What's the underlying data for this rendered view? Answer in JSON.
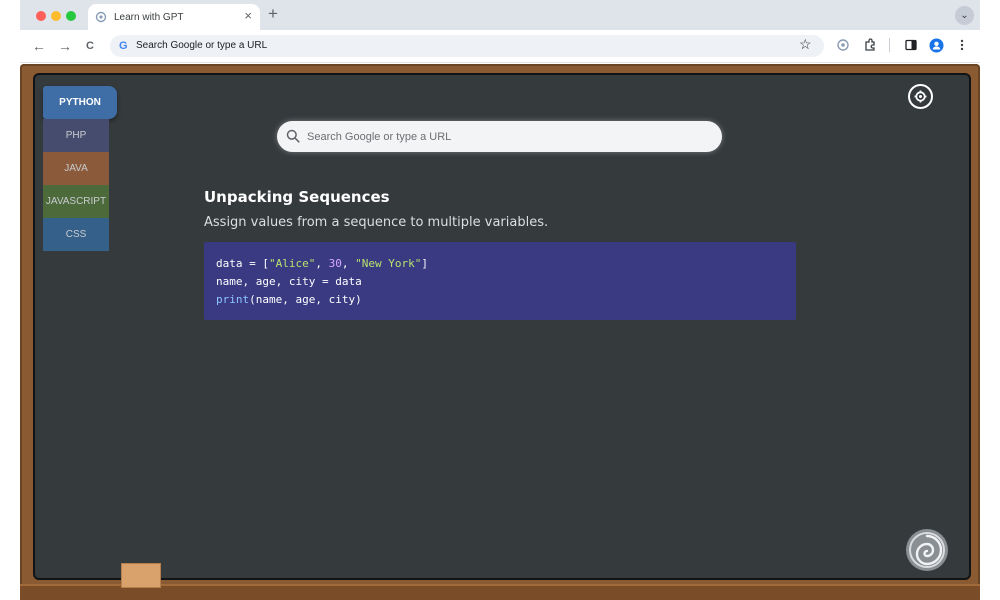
{
  "browser": {
    "tab_title": "Learn with GPT",
    "tab_close": "×",
    "new_tab": "+",
    "address_placeholder": "Search Google or type a URL",
    "nav_back": "←",
    "nav_forward": "→",
    "nav_reload": "C",
    "omnibox_g": "G",
    "star": "☆",
    "tab_menu": "⌄"
  },
  "languages": [
    {
      "label": "PYTHON",
      "color": "#3f6ea6",
      "active": true
    },
    {
      "label": "PHP",
      "color": "#454c6e",
      "active": false
    },
    {
      "label": "JAVA",
      "color": "#8a5a3a",
      "active": false
    },
    {
      "label": "JAVASCRIPT",
      "color": "#4d6a3b",
      "active": false
    },
    {
      "label": "CSS",
      "color": "#356089",
      "active": false
    }
  ],
  "search": {
    "placeholder": "Search Google or type a URL"
  },
  "lesson": {
    "title": "Unpacking Sequences",
    "subtitle": "Assign values from a sequence to multiple variables.",
    "code": {
      "l1_a": "data = [",
      "l1_s1": "\"Alice\"",
      "l1_c1": ", ",
      "l1_n": "30",
      "l1_c2": ", ",
      "l1_s2": "\"New York\"",
      "l1_b": "]",
      "l2": "name, age, city = data",
      "l3_f": "print",
      "l3_rest": "(name, age, city)"
    }
  },
  "colors": {
    "board": "#353a3d",
    "frame": "#8a5a32",
    "code_bg": "#3a3a83",
    "accent": "#3f6ea6"
  },
  "icons": {
    "settings": "gear-icon",
    "logo": "swirl-logo-icon",
    "search": "search-icon"
  }
}
